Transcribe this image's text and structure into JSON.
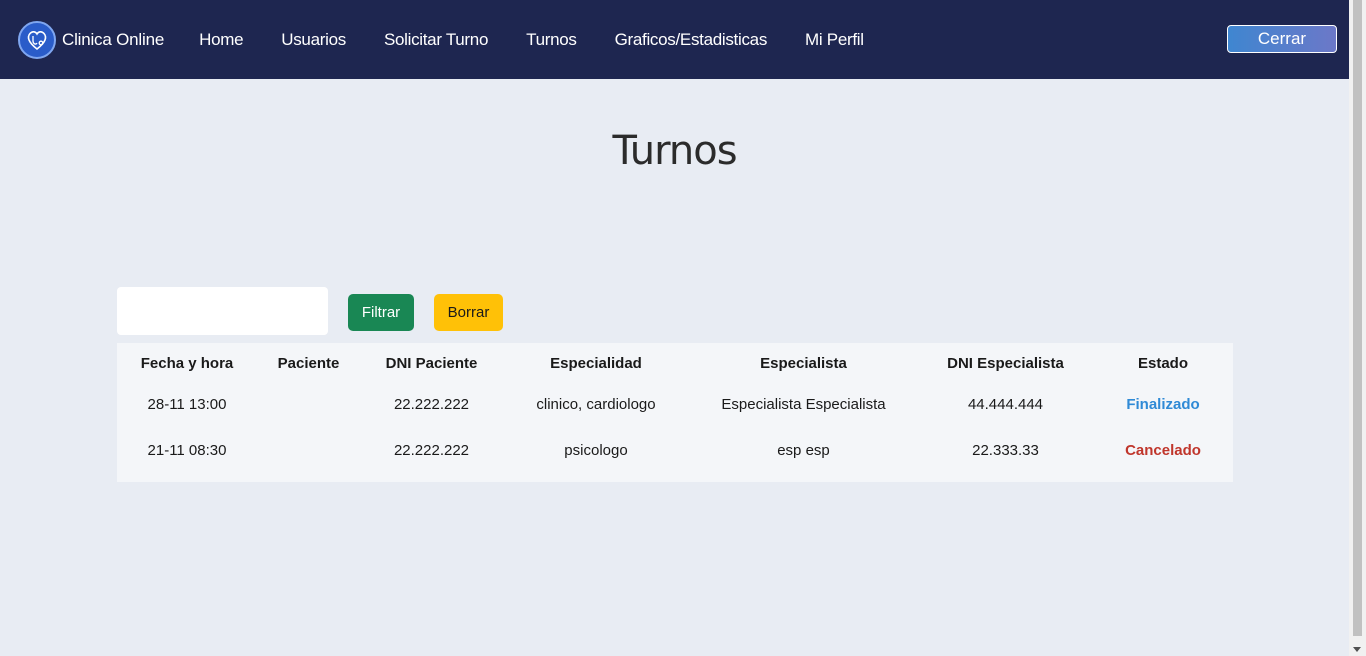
{
  "navbar": {
    "brand": "Clinica Online",
    "links": [
      "Home",
      "Usuarios",
      "Solicitar Turno",
      "Turnos",
      "Graficos/Estadisticas",
      "Mi Perfil"
    ],
    "logout_label": "Cerrar",
    "colors": {
      "background": "#1e2650",
      "logout_gradient_start": "#3f86d0",
      "logout_gradient_end": "#6c78c8"
    }
  },
  "page": {
    "title": "Turnos"
  },
  "filter": {
    "input_value": "",
    "filter_label": "Filtrar",
    "clear_label": "Borrar",
    "colors": {
      "filter": "#198754",
      "clear": "#ffc107"
    }
  },
  "table": {
    "headers": [
      "Fecha y hora",
      "Paciente",
      "DNI Paciente",
      "Especialidad",
      "Especialista",
      "DNI Especialista",
      "Estado"
    ],
    "rows": [
      {
        "fecha": "28-11 13:00",
        "paciente": "",
        "dni_paciente": "22.222.222",
        "especialidad": "clinico, cardiologo",
        "especialista": "Especialista Especialista",
        "dni_especialista": "44.444.444",
        "estado": "Finalizado"
      },
      {
        "fecha": "21-11 08:30",
        "paciente": "",
        "dni_paciente": "22.222.222",
        "especialidad": "psicologo",
        "especialista": "esp esp",
        "dni_especialista": "22.333.33",
        "estado": "Cancelado"
      }
    ],
    "status_colors": {
      "Finalizado": "#2f8ad6",
      "Cancelado": "#c0362c"
    }
  }
}
